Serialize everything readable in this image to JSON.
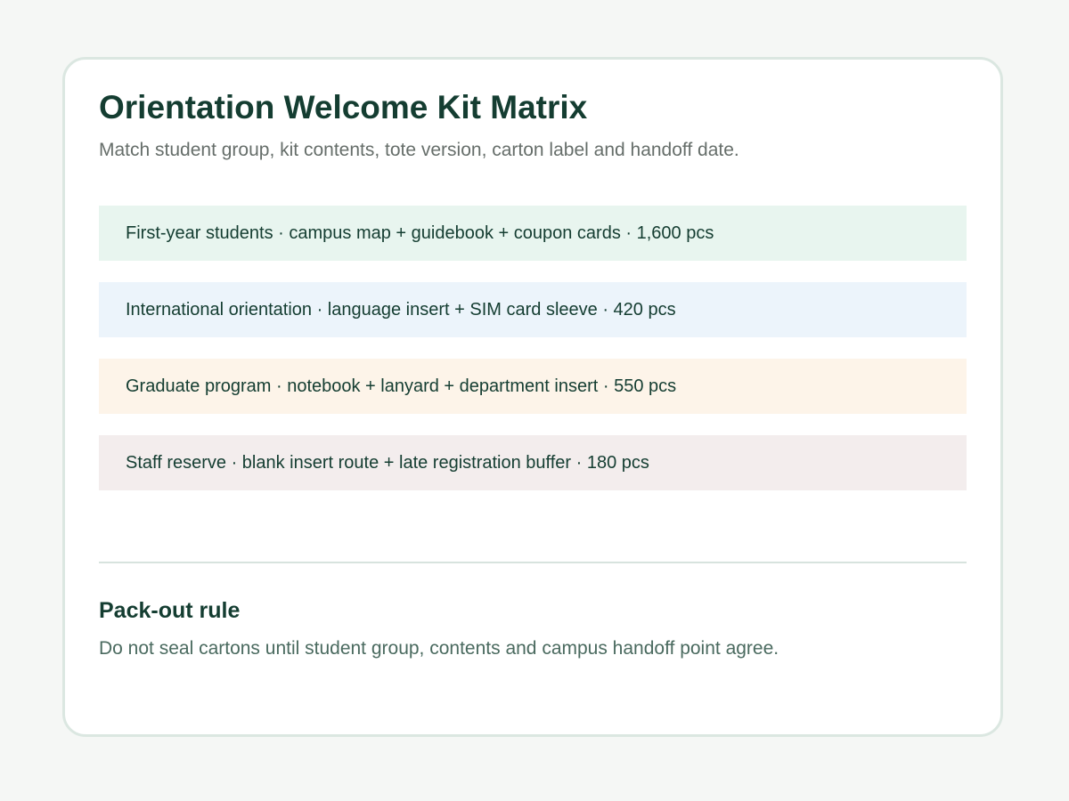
{
  "header": {
    "title": "Orientation Welcome Kit Matrix",
    "subtitle": "Match student group, kit contents, tote version, carton label and handoff date."
  },
  "rows": [
    {
      "text": "First-year students · campus map + guidebook + coupon cards · 1,600 pcs",
      "bg": "#e8f5ef"
    },
    {
      "text": "International orientation · language insert + SIM card sleeve · 420 pcs",
      "bg": "#ecf4fb"
    },
    {
      "text": "Graduate program · notebook + lanyard + department insert · 550 pcs",
      "bg": "#fdf4e9"
    },
    {
      "text": "Staff reserve · blank insert route + late registration buffer · 180 pcs",
      "bg": "#f3eded"
    }
  ],
  "rule": {
    "title": "Pack-out rule",
    "text": "Do not seal cartons until student group, contents and campus handoff point agree."
  },
  "colors": {
    "heading": "#143d31",
    "page_background": "#f5f7f5",
    "card_border": "#dbe7e1"
  }
}
